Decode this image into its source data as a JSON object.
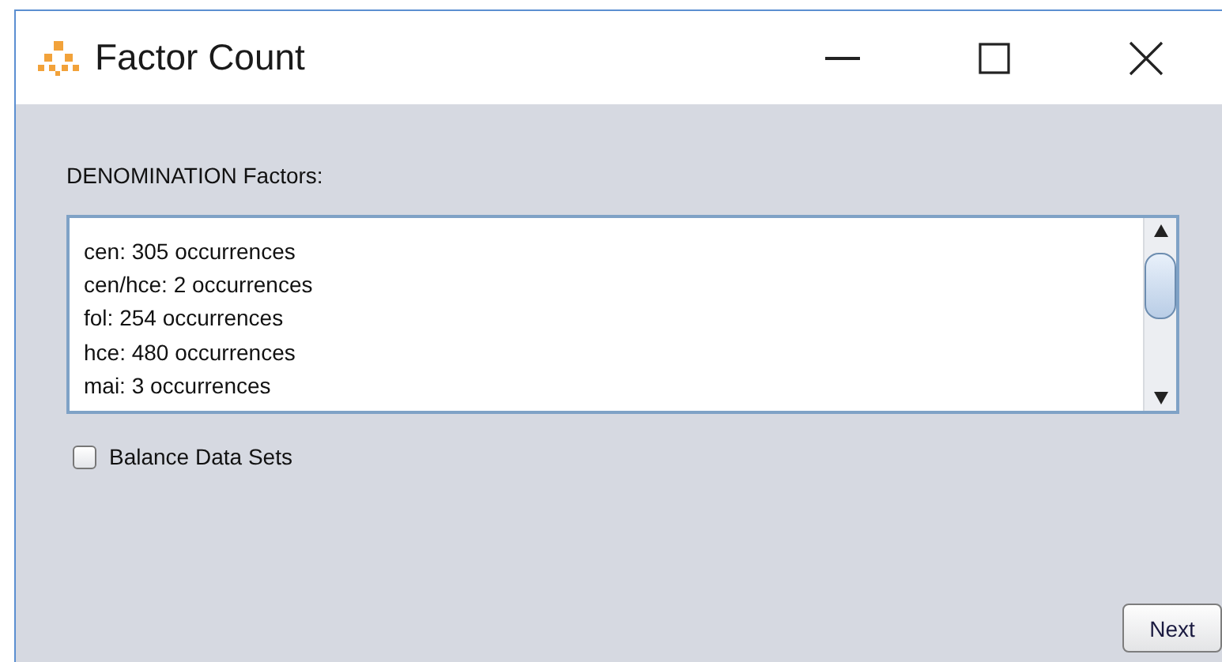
{
  "window": {
    "title": "Factor Count"
  },
  "factors_label": "DENOMINATION Factors:",
  "factors": [
    "cen: 305 occurrences",
    "cen/hce: 2 occurrences",
    "fol: 254 occurrences",
    "hce: 480 occurrences",
    "mai: 3 occurrences"
  ],
  "balance_checkbox": {
    "label": "Balance Data Sets",
    "checked": false
  },
  "buttons": [
    "Next"
  ]
}
